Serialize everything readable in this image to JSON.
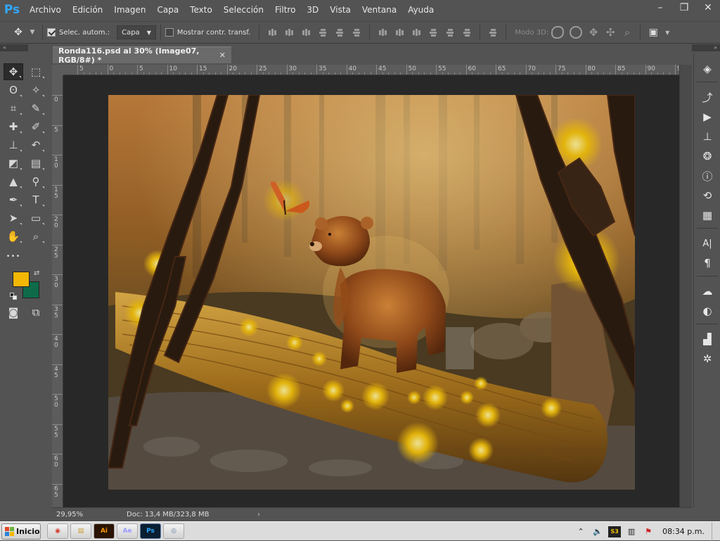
{
  "app": {
    "logo": "Ps",
    "menu": [
      "Archivo",
      "Edición",
      "Imagen",
      "Capa",
      "Texto",
      "Selección",
      "Filtro",
      "3D",
      "Vista",
      "Ventana",
      "Ayuda"
    ],
    "window_controls": {
      "minimize": "–",
      "restore": "❐",
      "close": "✕"
    }
  },
  "options": {
    "auto_select_label": "Selec. autom.:",
    "auto_select_checked": true,
    "target_value": "Capa",
    "transform_label": "Mostrar contr. transf.",
    "transform_checked": false,
    "mode3d_label": "Modo 3D:"
  },
  "tools": {
    "foreground_color": "#f2b705",
    "background_color": "#0f6a4a",
    "items": [
      {
        "name": "move-tool-icon",
        "glyph": "✥"
      },
      {
        "name": "marquee-tool-icon",
        "glyph": "⬚"
      },
      {
        "name": "lasso-tool-icon",
        "glyph": "ʘ"
      },
      {
        "name": "magic-wand-tool-icon",
        "glyph": "✧"
      },
      {
        "name": "crop-tool-icon",
        "glyph": "⌗"
      },
      {
        "name": "eyedropper-tool-icon",
        "glyph": "✎"
      },
      {
        "name": "healing-brush-tool-icon",
        "glyph": "✚"
      },
      {
        "name": "brush-tool-icon",
        "glyph": "✐"
      },
      {
        "name": "clone-stamp-tool-icon",
        "glyph": "⊥"
      },
      {
        "name": "history-brush-tool-icon",
        "glyph": "↶"
      },
      {
        "name": "eraser-tool-icon",
        "glyph": "◩"
      },
      {
        "name": "gradient-tool-icon",
        "glyph": "▤"
      },
      {
        "name": "blur-tool-icon",
        "glyph": "▲"
      },
      {
        "name": "dodge-tool-icon",
        "glyph": "⚲"
      },
      {
        "name": "pen-tool-icon",
        "glyph": "✒"
      },
      {
        "name": "type-tool-icon",
        "glyph": "T"
      },
      {
        "name": "path-selection-tool-icon",
        "glyph": "➤"
      },
      {
        "name": "rectangle-tool-icon",
        "glyph": "▭"
      },
      {
        "name": "hand-tool-icon",
        "glyph": "✋"
      },
      {
        "name": "zoom-tool-icon",
        "glyph": "⌕"
      },
      {
        "name": "more-tools-icon",
        "glyph": "•••"
      },
      {
        "name": "spacer",
        "glyph": ""
      },
      {
        "name": "quick-mask-icon",
        "glyph": "◙"
      },
      {
        "name": "screen-mode-icon",
        "glyph": "⧉"
      }
    ]
  },
  "document": {
    "tab_title": "Ronda116.psd al 30% (Image07, RGB/8#) *",
    "close": "✕"
  },
  "rulers": {
    "horizontal_labels": [
      "5",
      "0",
      "5",
      "10",
      "15",
      "20",
      "25",
      "30",
      "35",
      "40",
      "45",
      "50",
      "55",
      "60",
      "65",
      "70",
      "75",
      "80",
      "85",
      "90",
      "9"
    ],
    "vertical_labels": [
      "0",
      "5",
      "10",
      "15",
      "20",
      "25",
      "30",
      "35",
      "40",
      "45",
      "50",
      "55",
      "60",
      "65"
    ]
  },
  "status": {
    "zoom": "29,95%",
    "doc_info": "Doc: 13,4 MB/323,8 MB",
    "arrow": "›"
  },
  "right_panels": [
    "layers-panel-icon",
    "paths-panel-icon",
    "actions-panel-icon",
    "clone-source-panel-icon",
    "channels-panel-icon",
    "info-panel-icon",
    "history-panel-icon",
    "3d-panel-icon",
    "character-panel-icon",
    "paragraph-panel-icon",
    "libraries-panel-icon",
    "adjustments-panel-icon",
    "histogram-panel-icon",
    "navigator-panel-icon"
  ],
  "taskbar": {
    "start_label": "Inicio",
    "apps": [
      {
        "name": "chrome-taskbar-icon",
        "label": "◉",
        "color": "#d23a2a"
      },
      {
        "name": "explorer-taskbar-icon",
        "label": "▤",
        "color": "#c79a2c"
      },
      {
        "name": "illustrator-taskbar-icon",
        "label": "Ai",
        "color": "#ff9a00"
      },
      {
        "name": "after-effects-taskbar-icon",
        "label": "Ae",
        "color": "#9999ff"
      },
      {
        "name": "photoshop-taskbar-icon",
        "label": "Ps",
        "color": "#31a8ff"
      },
      {
        "name": "extra-taskbar-icon",
        "label": "◎",
        "color": "#5a7a9a"
      }
    ],
    "clock": "08:34 p.m."
  }
}
